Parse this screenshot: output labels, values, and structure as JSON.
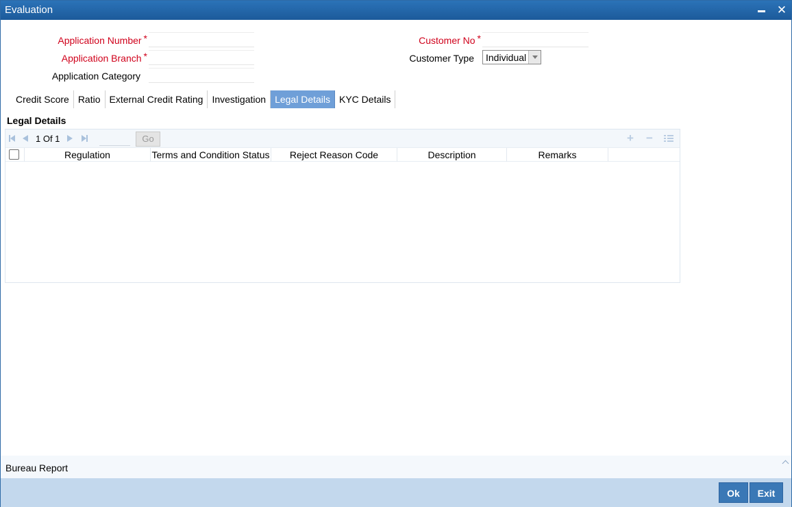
{
  "window": {
    "title": "Evaluation",
    "minimize_icon": "minimize-icon",
    "close_icon": "close-icon",
    "close_glyph": "✕"
  },
  "form": {
    "application_number": {
      "label": "Application Number",
      "required": "*",
      "value": ""
    },
    "application_branch": {
      "label": "Application Branch",
      "required": "*",
      "value": ""
    },
    "application_category": {
      "label": "Application Category",
      "value": ""
    },
    "customer_no": {
      "label": "Customer No",
      "required": "*",
      "value": ""
    },
    "customer_type": {
      "label": "Customer Type",
      "selected": "Individual"
    }
  },
  "tabs": [
    {
      "label": "Credit Score",
      "active": false
    },
    {
      "label": "Ratio",
      "active": false
    },
    {
      "label": "External Credit Rating",
      "active": false
    },
    {
      "label": "Investigation",
      "active": false
    },
    {
      "label": "Legal Details",
      "active": true
    },
    {
      "label": "KYC Details",
      "active": false
    }
  ],
  "legal_details": {
    "section_title": "Legal Details",
    "pagination": {
      "text": "1 Of 1",
      "page_input": "",
      "go_label": "Go"
    },
    "columns": [
      "Regulation",
      "Terms and Condition Status",
      "Reject Reason Code",
      "Description",
      "Remarks"
    ],
    "rows": [],
    "toolbar": {
      "add_glyph": "+",
      "delete_glyph": "−"
    }
  },
  "bureau": {
    "label": "Bureau Report"
  },
  "footer": {
    "ok_label": "Ok",
    "exit_label": "Exit"
  },
  "colors": {
    "titlebar": "#1f63a8",
    "required_label": "#d0011b",
    "active_tab": "#6f9fd8",
    "footer_bar": "#c3d8ed",
    "button": "#3a78b6"
  }
}
